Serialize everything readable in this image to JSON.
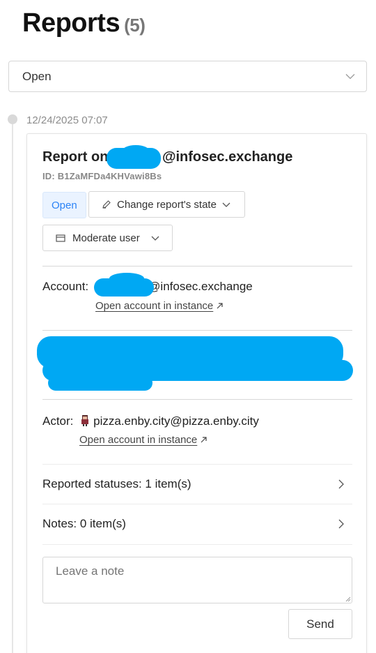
{
  "header": {
    "title": "Reports",
    "count": "(5)"
  },
  "filter": {
    "selected": "Open"
  },
  "report": {
    "timestamp": "12/24/2025 07:07",
    "title_prefix": "Report on ",
    "title_suffix": "@infosec.exchange",
    "id": "ID: B1ZaMFDa4KHVawi8Bs",
    "state": "Open",
    "change_state_label": "Change report's state",
    "moderate_label": "Moderate user",
    "account_label": "Account:",
    "account_suffix": "@infosec.exchange",
    "open_account_label": "Open account in instance",
    "actor_label": "Actor:",
    "actor_handle": "pizza.enby.city@pizza.enby.city",
    "actor_open_label": "Open account in instance",
    "reported_statuses": "Reported statuses: 1 item(s)",
    "notes": "Notes: 0 item(s)",
    "note_placeholder": "Leave a note",
    "send_label": "Send"
  },
  "colors": {
    "accent": "#2b83f6",
    "redaction": "#00a8f3",
    "tag_bg": "#eaf3ff"
  },
  "icons": [
    "chevron-down-icon",
    "pencil-icon",
    "inbox-icon",
    "external-link-icon",
    "chevron-right-icon",
    "avatar-icon",
    "resize-grip-icon"
  ]
}
